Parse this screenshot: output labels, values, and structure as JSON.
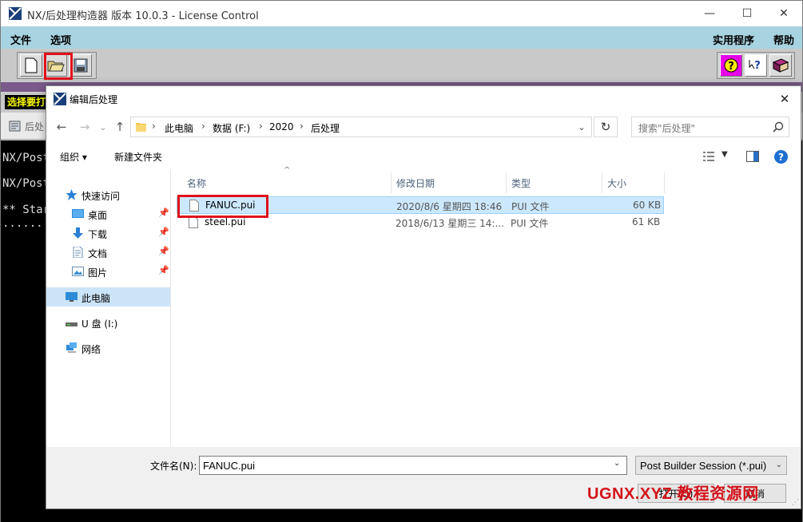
{
  "app": {
    "title": "NX/后处理构造器 版本 10.0.3 - License Control",
    "window_controls": {
      "minimize": "—",
      "maximize": "☐",
      "close": "✕"
    }
  },
  "menu": {
    "file": "文件",
    "options": "选项",
    "utilities": "实用程序",
    "help": "帮助"
  },
  "toolbar": {
    "left_tools": [
      "new-file-icon",
      "open-file-icon",
      "save-file-icon"
    ],
    "right_tools": [
      "help-question-icon",
      "context-help-icon",
      "manual-book-icon"
    ]
  },
  "prompt": {
    "label": "选择要打"
  },
  "session_tab": {
    "label": "后处"
  },
  "console": {
    "lines": [
      "NX/Post",
      "NX/Post",
      "** Star",
      "......."
    ]
  },
  "dialog": {
    "title": "编辑后处理",
    "close": "✕",
    "nav": {
      "back": "←",
      "forward": "→",
      "recent": "⌄",
      "up": "↑"
    },
    "breadcrumb": [
      "此电脑",
      "数据 (F:)",
      "2020",
      "后处理"
    ],
    "search_placeholder": "搜索\"后处理\"",
    "commands": {
      "organize": "组织 ▾",
      "new_folder": "新建文件夹"
    },
    "sidebar": {
      "quick_access": "快速访问",
      "items": [
        {
          "label": "桌面",
          "pinned": true
        },
        {
          "label": "下载",
          "pinned": true
        },
        {
          "label": "文档",
          "pinned": true
        },
        {
          "label": "图片",
          "pinned": true
        }
      ],
      "this_pc": "此电脑",
      "usb_drive": "U 盘 (I:)",
      "network": "网络"
    },
    "columns": {
      "name": "名称",
      "modified": "修改日期",
      "type": "类型",
      "size": "大小"
    },
    "files": [
      {
        "name": "FANUC.pui",
        "modified": "2020/8/6 星期四 18:46",
        "type": "PUI 文件",
        "size": "60 KB",
        "selected": true
      },
      {
        "name": "steel.pui",
        "modified": "2018/6/13 星期三 14:...",
        "type": "PUI 文件",
        "size": "61 KB",
        "selected": false
      }
    ],
    "filename_label": "文件名(N):",
    "filename_value": "FANUC.pui",
    "filetype": "Post Builder Session (*.pui)",
    "open_button": "打开(O)",
    "cancel_button": "取消"
  },
  "watermark": "UGNX.XYZ 教程资源网",
  "colors": {
    "menu_bg": "#a8d3e0",
    "highlight_red": "#e0101a",
    "selection_blue": "#cce8ff",
    "console_bg": "#000000"
  }
}
